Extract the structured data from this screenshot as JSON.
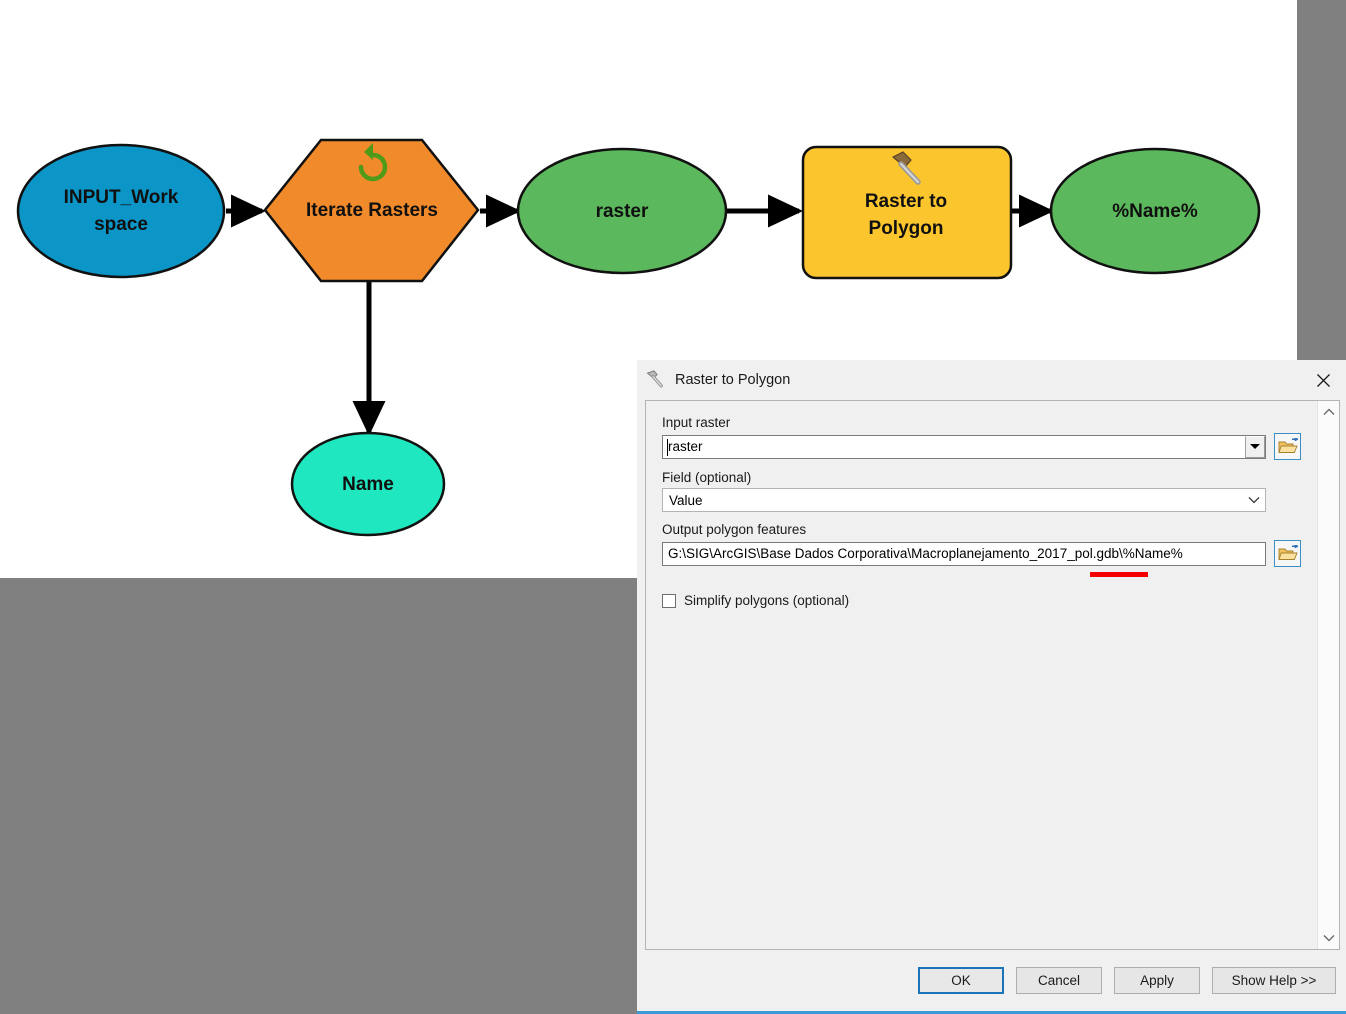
{
  "canvas": {
    "background_color": "#ffffff",
    "outer_background_color": "#808080",
    "nodes": [
      {
        "id": "input_workspace",
        "label_line1": "INPUT_Work",
        "label_line2": "space",
        "shape": "ellipse",
        "color": "#0c96c8",
        "icon": ""
      },
      {
        "id": "iterate_rasters",
        "label_line1": "Iterate Rasters",
        "label_line2": "",
        "shape": "hexagon",
        "color": "#f08a2a",
        "icon": "loop-arrow-icon"
      },
      {
        "id": "raster",
        "label_line1": "raster",
        "label_line2": "",
        "shape": "ellipse",
        "color": "#5cb85c",
        "icon": ""
      },
      {
        "id": "raster_to_polygon",
        "label_line1": "Raster to",
        "label_line2": "Polygon",
        "shape": "rounded-rect",
        "color": "#fbc52d",
        "icon": "hammer-icon"
      },
      {
        "id": "name_out",
        "label_line1": "%Name%",
        "label_line2": "",
        "shape": "ellipse",
        "color": "#5cb85c",
        "icon": ""
      },
      {
        "id": "name_var",
        "label_line1": "Name",
        "label_line2": "",
        "shape": "ellipse",
        "color": "#1fe7c0",
        "icon": ""
      }
    ]
  },
  "dialog": {
    "title": "Raster to Polygon",
    "title_icon": "hammer-icon",
    "close_icon": "close-icon",
    "params": {
      "input_raster": {
        "label": "Input raster",
        "value": "raster",
        "dropdown_icon": "triangle-down-icon",
        "browse_icon": "open-folder-icon"
      },
      "field": {
        "label": "Field (optional)",
        "value": "Value",
        "dropdown_icon": "chevron-down-icon"
      },
      "output_polygon_features": {
        "label": "Output polygon features",
        "value": "G:\\SIG\\ArcGIS\\Base Dados Corporativa\\Macroplanejamento_2017_pol.gdb\\%Name%",
        "highlighted_token": "%Name%",
        "highlight_color": "#f40000",
        "browse_icon": "open-folder-icon"
      },
      "simplify_polygons": {
        "label": "Simplify polygons (optional)",
        "checked": false
      }
    },
    "scrollbar": {
      "up_icon": "chevron-up-icon",
      "down_icon": "chevron-down-icon"
    },
    "footer_buttons": [
      {
        "id": "ok",
        "label": "OK",
        "primary": true
      },
      {
        "id": "cancel",
        "label": "Cancel",
        "primary": false
      },
      {
        "id": "apply",
        "label": "Apply",
        "primary": false
      },
      {
        "id": "show_help",
        "label": "Show Help >>",
        "primary": false
      }
    ]
  }
}
